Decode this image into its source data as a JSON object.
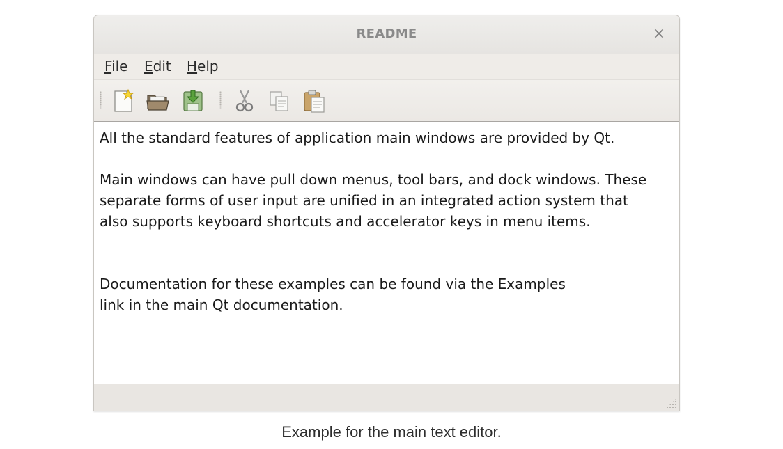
{
  "window": {
    "title": "README",
    "close_glyph": "×"
  },
  "menubar": {
    "items": [
      {
        "mnemonic": "F",
        "rest": "ile"
      },
      {
        "mnemonic": "E",
        "rest": "dit"
      },
      {
        "mnemonic": "H",
        "rest": "elp"
      }
    ]
  },
  "toolbar": {
    "file_group": [
      "new-file-icon",
      "open-folder-icon",
      "save-icon"
    ],
    "edit_group": [
      "cut-icon",
      "copy-icon",
      "paste-icon"
    ]
  },
  "editor": {
    "paragraphs": [
      "All the standard features of application main windows are provided by Qt.",
      "Main windows can have pull down menus, tool bars, and dock windows. These\nseparate forms of user input are unified in an integrated action system that\nalso supports keyboard shortcuts and accelerator keys in menu items.",
      "Documentation for these examples can be found via the Examples\nlink in the main Qt documentation."
    ]
  },
  "caption": "Example for the main text editor."
}
